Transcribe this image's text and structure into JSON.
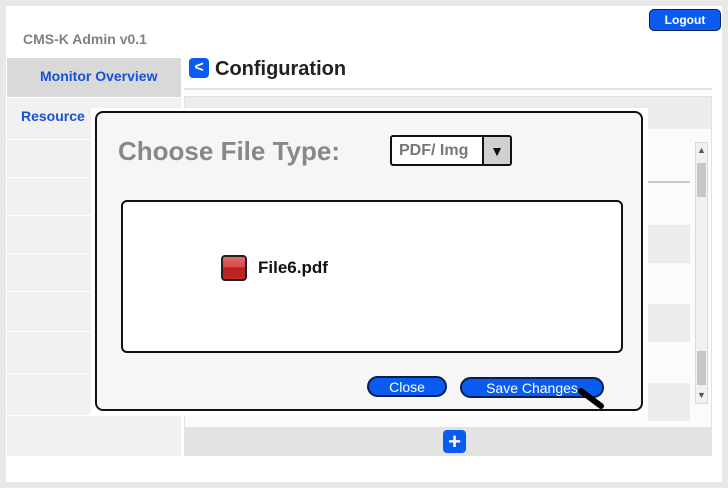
{
  "app": {
    "title": "CMS-K Admin v0.1",
    "logout_label": "Logout"
  },
  "sidebar": {
    "items": [
      {
        "label": "Monitor Overview"
      },
      {
        "label": "Resource"
      }
    ]
  },
  "page": {
    "back_icon": "chevron-left-icon",
    "back_glyph": "<",
    "title": "Configuration",
    "add_icon": "plus-icon",
    "add_glyph": "+"
  },
  "dialog": {
    "title": "Choose File Type:",
    "file_type": {
      "selected": "PDF/ Img",
      "arrow_glyph": "▼"
    },
    "file": {
      "icon": "pdf-file-icon",
      "name": "File6.pdf"
    },
    "close_label": "Close",
    "save_label": "Save Changes"
  },
  "scrollbar": {
    "up_glyph": "▲",
    "down_glyph": "▼"
  },
  "colors": {
    "accent": "#0a5cf0",
    "link": "#1551d8",
    "muted": "#888888"
  }
}
